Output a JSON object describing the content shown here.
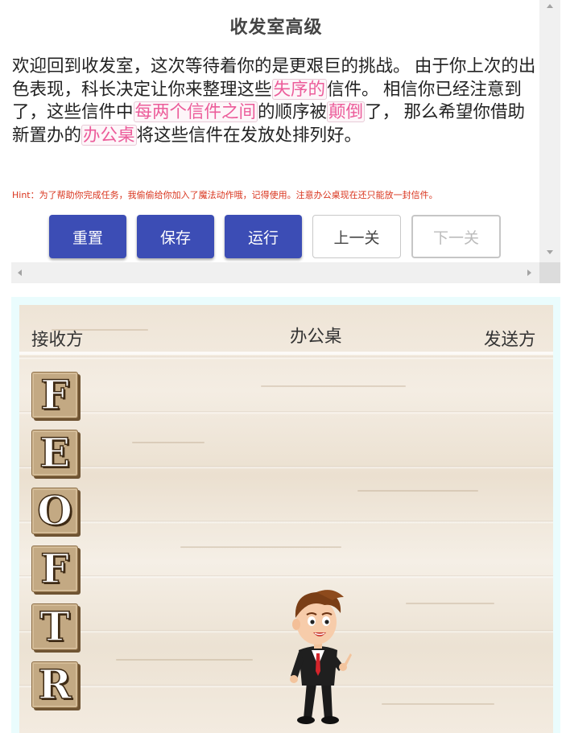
{
  "title": "收发室高级",
  "description": {
    "p1": "欢迎回到收发室，这次等待着你的是更艰巨的挑战。 由于你上次的出色表现，科长决定让你来整理这些",
    "hl1": "失序的",
    "p2": "信件。 相信你已经注意到了，这些信件中",
    "hl2": "每两个信件之间",
    "p3": "的顺序被",
    "hl3": "颠倒",
    "p4": "了， 那么希望你借助新置办的",
    "hl4": "办公桌",
    "p5": "将这些信件在发放处排列好。"
  },
  "hint": "Hint：为了帮助你完成任务，我偷偷给你加入了魔法动作哦，记得使用。注意办公桌现在还只能放一封信件。",
  "buttons": {
    "reset": "重置",
    "save": "保存",
    "run": "运行",
    "prev": "上一关",
    "next": "下一关"
  },
  "board": {
    "receiver_label": "接收方",
    "desk_label": "办公桌",
    "sender_label": "发送方",
    "letters": [
      "F",
      "E",
      "O",
      "F",
      "T",
      "R"
    ]
  },
  "colors": {
    "primary_button": "#3c4db5",
    "highlight_text": "#ec5c9a",
    "hint_text": "#d9341d"
  }
}
